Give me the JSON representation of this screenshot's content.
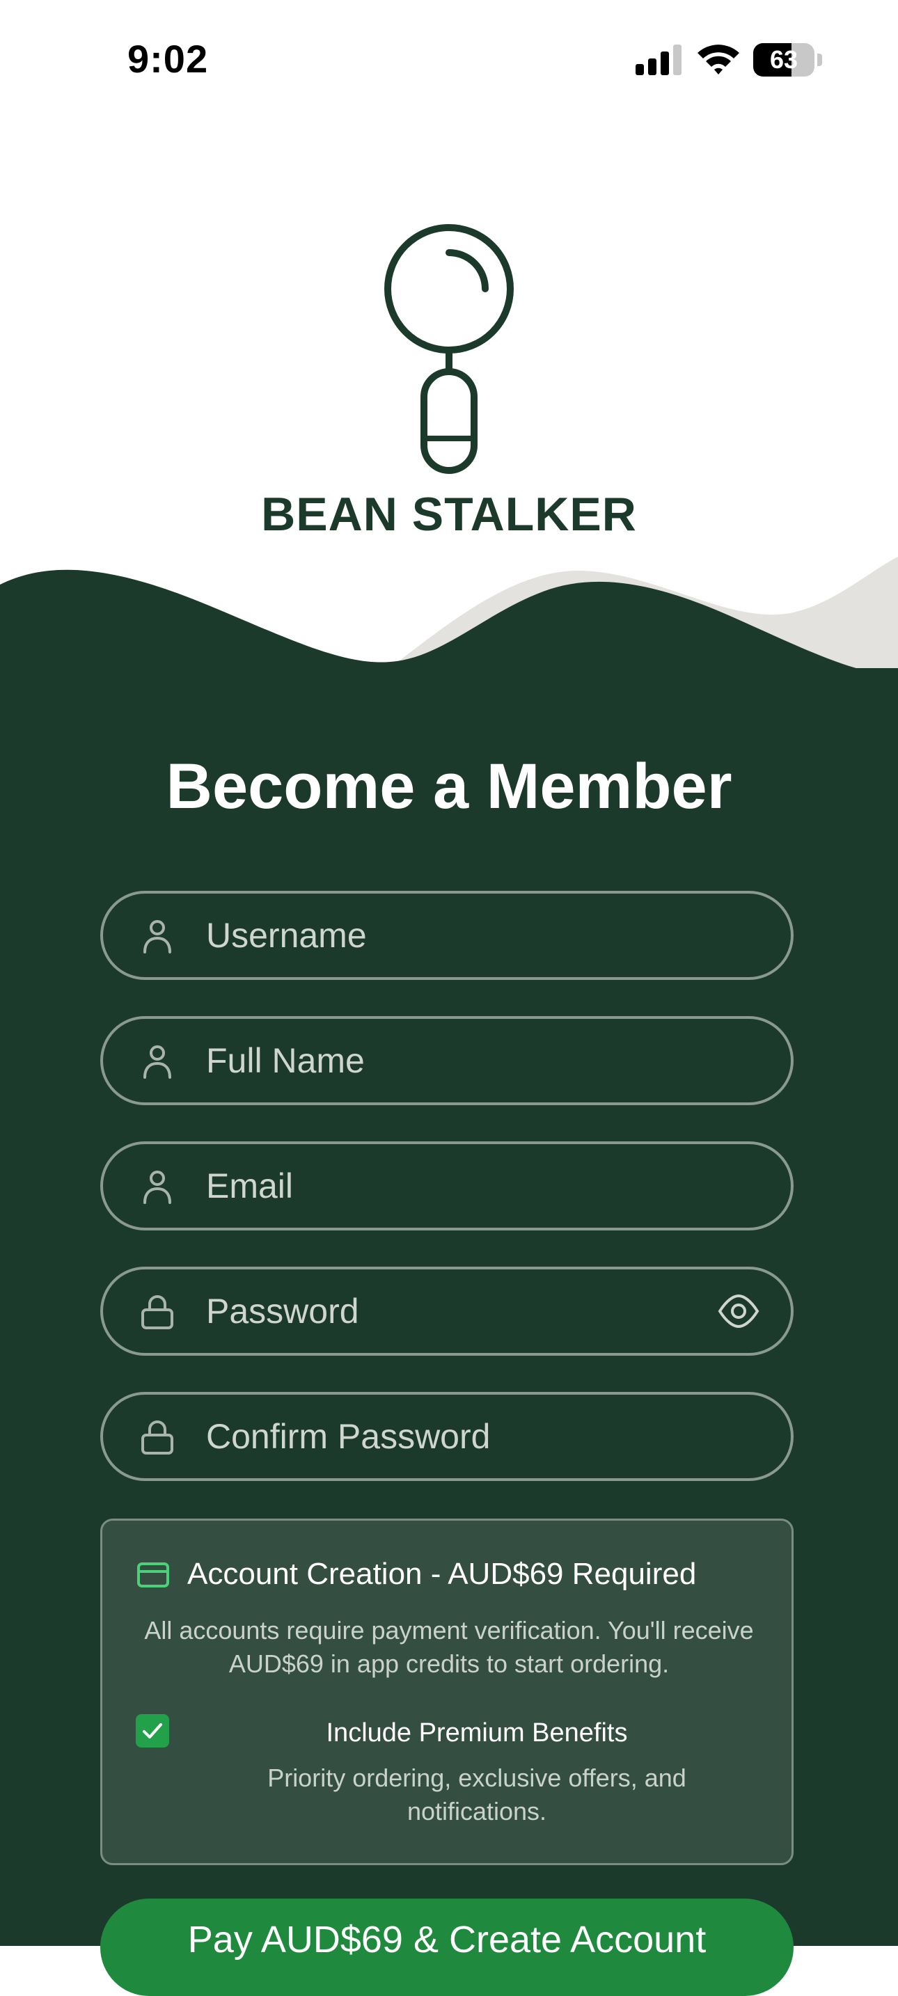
{
  "status_bar": {
    "time": "9:02",
    "battery_level": "63"
  },
  "brand": {
    "name": "BEAN STALKER",
    "primary_color": "#1c3a2b",
    "wave_accent_color": "#e4e2de"
  },
  "form": {
    "title": "Become a Member",
    "fields": {
      "username": {
        "placeholder": "Username",
        "icon": "user-icon"
      },
      "full_name": {
        "placeholder": "Full Name",
        "icon": "user-icon"
      },
      "email": {
        "placeholder": "Email",
        "icon": "user-icon"
      },
      "password": {
        "placeholder": "Password",
        "icon": "lock-icon",
        "toggle_icon": "eye-icon"
      },
      "confirm_password": {
        "placeholder": "Confirm Password",
        "icon": "lock-icon"
      }
    }
  },
  "payment": {
    "icon": "credit-card-icon",
    "title": "Account Creation - AUD$69 Required",
    "description": "All accounts require payment verification. You'll receive AUD$69 in app credits to start ordering.",
    "premium": {
      "checked": true,
      "title": "Include Premium Benefits",
      "description": "Priority ordering, exclusive offers, and notifications."
    }
  },
  "submit": {
    "label": "Pay AUD$69 & Create Account",
    "color": "#1f8a3e"
  }
}
